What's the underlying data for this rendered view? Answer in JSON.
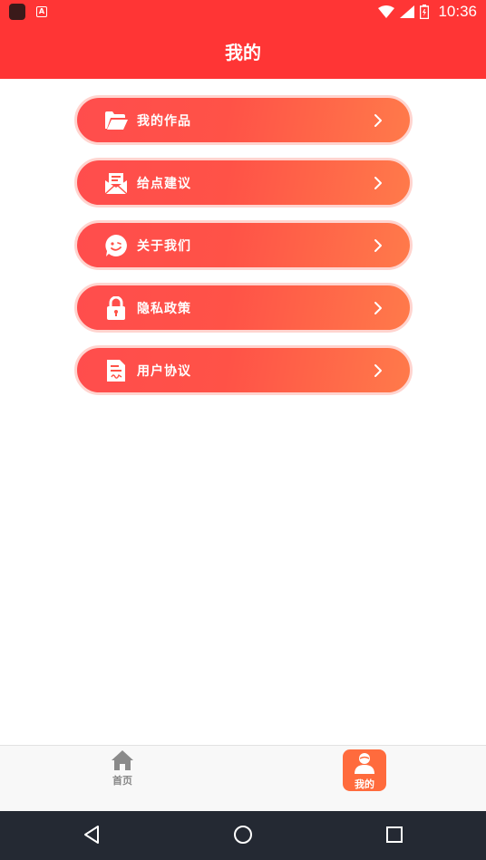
{
  "status_bar": {
    "time": "10:36",
    "notification_letter": "A"
  },
  "header": {
    "title": "我的"
  },
  "menu": [
    {
      "label": "我的作品",
      "icon": "folder-icon"
    },
    {
      "label": "给点建议",
      "icon": "envelope-icon"
    },
    {
      "label": "关于我们",
      "icon": "smiley-chat-icon"
    },
    {
      "label": "隐私政策",
      "icon": "lock-icon"
    },
    {
      "label": "用户协议",
      "icon": "document-icon"
    }
  ],
  "tabs": [
    {
      "label": "首页",
      "icon": "home-icon",
      "active": false
    },
    {
      "label": "我的",
      "icon": "user-icon",
      "active": true
    }
  ],
  "colors": {
    "primary": "#ff3535",
    "accent": "#ff6b3d",
    "nav_bar": "#242933"
  }
}
